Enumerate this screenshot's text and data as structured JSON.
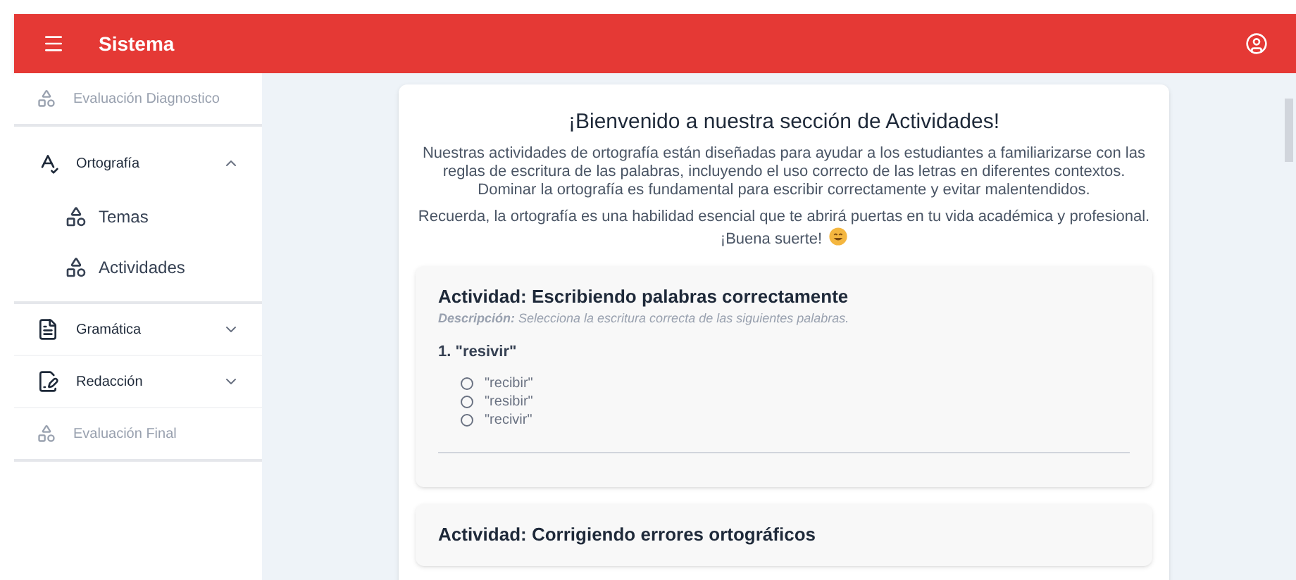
{
  "header": {
    "title": "Sistema"
  },
  "sidebar": {
    "items": [
      {
        "label": "Evaluación Diagnostico",
        "kind": "link",
        "disabled": true
      },
      {
        "label": "Ortografía",
        "kind": "group",
        "expanded": true,
        "children": [
          {
            "label": "Temas"
          },
          {
            "label": "Actividades"
          }
        ]
      },
      {
        "label": "Gramática",
        "kind": "group",
        "expanded": false
      },
      {
        "label": "Redacción",
        "kind": "group",
        "expanded": false
      },
      {
        "label": "Evaluación Final",
        "kind": "link",
        "disabled": true
      }
    ]
  },
  "intro": {
    "title": "¡Bienvenido a nuestra sección de Actividades!",
    "paragraphs": [
      "Nuestras actividades de ortografía están diseñadas para ayudar a los estudiantes a familiarizarse con las reglas de escritura de las palabras, incluyendo el uso correcto de las letras en diferentes contextos. Dominar la ortografía es fundamental para escribir correctamente y evitar malentendidos.",
      "Recuerda, la ortografía es una habilidad esencial que te abrirá puertas en tu vida académica y profesional. ¡Buena suerte!"
    ]
  },
  "activities": [
    {
      "title": "Actividad: Escribiendo palabras correctamente",
      "description": "**Descripción:** Selecciona la escritura correcta de las siguientes palabras.",
      "questions": [
        {
          "prompt": "1. \"resivir\"",
          "options": [
            {
              "label": "\"recibir\"",
              "selected": false
            },
            {
              "label": "\"resibir\"",
              "selected": false
            },
            {
              "label": "\"recivir\"",
              "selected": false
            }
          ]
        }
      ]
    },
    {
      "title": "Actividad: Corrigiendo errores ortográficos"
    }
  ]
}
